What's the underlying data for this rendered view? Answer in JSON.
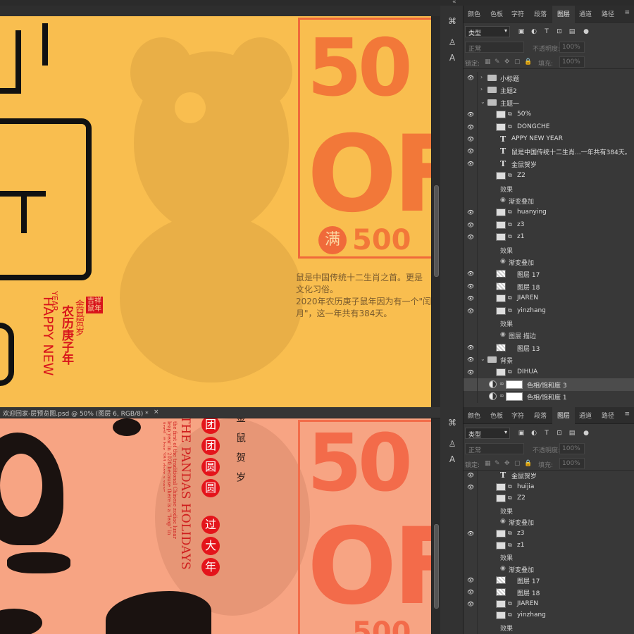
{
  "top_strip": {
    "collapse_glyph": "«"
  },
  "document_tab": {
    "label": "欢迎回家-层预览图.psd @ 50% (图层 6, RGB/8) *",
    "close": "×"
  },
  "poster_top": {
    "big_number_line1": "50",
    "big_number_line2": "OFF",
    "man": "满",
    "amount": "500",
    "description": [
      "鼠是中国传统十二生肖之首。更是",
      "文化习俗。",
      "2020年农历庚子鼠年因为有一个\"闰",
      "月\"，这一年共有384天。"
    ],
    "vertical_cn": "农历庚子年",
    "vertical_sub": "金鼠贺岁",
    "vertical_en_1": "HAPPY NEW",
    "vertical_en_2": "YEAR",
    "stamp": "吉祥鼠年"
  },
  "poster_bottom": {
    "circles": [
      "团",
      "团",
      "圆",
      "圆",
      "过",
      "大",
      "年"
    ],
    "vertical_dark": "金鼠贺岁",
    "vertical_en": "THE PANDAS HOLIDAYS",
    "small_en": "the first of the traditional Chinese zodiac lunar leap year in 2020 because there is a \"leap\" in April, it has 384 days a year",
    "big_number_line1": "50",
    "big_number_line2": "OFF",
    "amount_partial": "500"
  },
  "panel_tools": {
    "history": "⌘",
    "adjust": "♙",
    "char": "A"
  },
  "panel_tabs": [
    "颜色",
    "色板",
    "字符",
    "段落",
    "图层",
    "通道",
    "路径"
  ],
  "panel_menu": "≡",
  "layers_panel": {
    "filter_label": "类型",
    "filter_caret": "▾",
    "filter_icons": [
      "▣",
      "◐",
      "T",
      "⊡",
      "▤",
      "●"
    ],
    "blend_mode": "正常",
    "opacity_label": "不透明度:",
    "opacity_value": "100%",
    "lock_label": "锁定:",
    "lock_icons": [
      "▦",
      "✎",
      "✥",
      "▢",
      "🔒"
    ],
    "fill_label": "填充:",
    "fill_value": "100%"
  },
  "layers_top": [
    {
      "name": "小标题",
      "kind": "group",
      "eye": true,
      "indent": 0
    },
    {
      "name": "主题2",
      "kind": "group",
      "eye": false,
      "indent": 0
    },
    {
      "name": "主题一",
      "kind": "group-open",
      "eye": false,
      "indent": 0
    },
    {
      "name": "50%",
      "kind": "smart",
      "eye": true,
      "indent": 1
    },
    {
      "name": "DONGCHE",
      "kind": "smart",
      "eye": true,
      "indent": 1
    },
    {
      "name": "APPY NEW YEAR",
      "kind": "text",
      "eye": true,
      "indent": 1
    },
    {
      "name": "鼠是中国传统十二生肖...一年共有384天。",
      "kind": "text",
      "eye": true,
      "indent": 1
    },
    {
      "name": "金鼠贺岁",
      "kind": "text",
      "eye": true,
      "indent": 1
    },
    {
      "name": "Z2",
      "kind": "smart",
      "eye": false,
      "indent": 1
    },
    {
      "name": "效果",
      "kind": "fx",
      "eye": false,
      "indent": 2
    },
    {
      "name": "渐变叠加",
      "kind": "fx-item",
      "eye": false,
      "indent": 2
    },
    {
      "name": "huanying",
      "kind": "smart",
      "eye": true,
      "indent": 1
    },
    {
      "name": "z3",
      "kind": "smart",
      "eye": true,
      "indent": 1
    },
    {
      "name": "z1",
      "kind": "smart",
      "eye": true,
      "indent": 1
    },
    {
      "name": "效果",
      "kind": "fx",
      "eye": false,
      "indent": 2
    },
    {
      "name": "渐变叠加",
      "kind": "fx-item",
      "eye": false,
      "indent": 2
    },
    {
      "name": "图层 17",
      "kind": "pixel",
      "eye": true,
      "indent": 1
    },
    {
      "name": "图层 18",
      "kind": "pixel",
      "eye": true,
      "indent": 1
    },
    {
      "name": "JIAREN",
      "kind": "smart",
      "eye": true,
      "indent": 1
    },
    {
      "name": "yinzhang",
      "kind": "smart",
      "eye": true,
      "indent": 1
    },
    {
      "name": "效果",
      "kind": "fx",
      "eye": false,
      "indent": 2
    },
    {
      "name": "图层 描边",
      "kind": "fx-item",
      "eye": false,
      "indent": 2
    },
    {
      "name": "图层 13",
      "kind": "pixel",
      "eye": true,
      "indent": 1
    },
    {
      "name": "背景",
      "kind": "group-open",
      "eye": true,
      "indent": 0
    },
    {
      "name": "DIHUA",
      "kind": "smart",
      "eye": true,
      "indent": 1
    },
    {
      "name": "色相/饱和度 3",
      "kind": "adjust",
      "eye": false,
      "indent": 1,
      "selected": true
    },
    {
      "name": "色相/饱和度 1",
      "kind": "adjust",
      "eye": false,
      "indent": 1
    }
  ],
  "layers_bottom": [
    {
      "name": "金鼠贺岁",
      "kind": "text",
      "eye": true,
      "indent": 1
    },
    {
      "name": "huijia",
      "kind": "smart",
      "eye": true,
      "indent": 1
    },
    {
      "name": "Z2",
      "kind": "smart",
      "eye": false,
      "indent": 1
    },
    {
      "name": "效果",
      "kind": "fx",
      "eye": false,
      "indent": 2
    },
    {
      "name": "渐变叠加",
      "kind": "fx-item",
      "eye": false,
      "indent": 2
    },
    {
      "name": "z3",
      "kind": "smart",
      "eye": true,
      "indent": 1
    },
    {
      "name": "z1",
      "kind": "smart",
      "eye": false,
      "indent": 1
    },
    {
      "name": "效果",
      "kind": "fx",
      "eye": false,
      "indent": 2
    },
    {
      "name": "渐变叠加",
      "kind": "fx-item",
      "eye": false,
      "indent": 2
    },
    {
      "name": "图层 17",
      "kind": "pixel",
      "eye": true,
      "indent": 1
    },
    {
      "name": "图层 18",
      "kind": "pixel",
      "eye": true,
      "indent": 1
    },
    {
      "name": "JIAREN",
      "kind": "smart",
      "eye": true,
      "indent": 1
    },
    {
      "name": "yinzhang",
      "kind": "smart",
      "eye": false,
      "indent": 1
    },
    {
      "name": "效果",
      "kind": "fx",
      "eye": false,
      "indent": 2
    }
  ],
  "colors": {
    "poster_top_bg": "#f9be4f",
    "poster_bottom_bg": "#f7a483",
    "accent_orange": "#f27839",
    "red": "#d8141b",
    "panel_bg": "#383838"
  }
}
